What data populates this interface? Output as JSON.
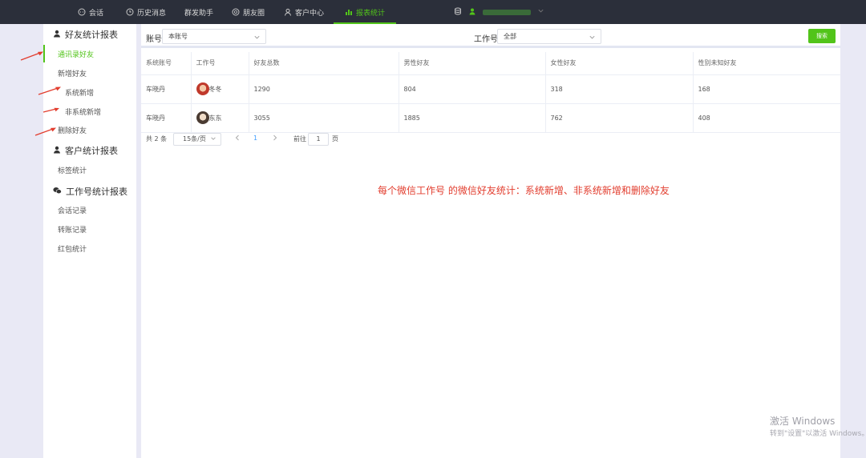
{
  "topnav": {
    "items": [
      {
        "label": "会话"
      },
      {
        "label": "历史消息"
      },
      {
        "label": "群发助手"
      },
      {
        "label": "朋友圈"
      },
      {
        "label": "客户中心"
      },
      {
        "label": "报表统计"
      }
    ],
    "accent": "#52c41a"
  },
  "sidebar": {
    "sections": [
      {
        "title": "好友统计报表",
        "items": [
          "通讯录好友",
          "新增好友",
          "系统新增",
          "非系统新增",
          "删除好友"
        ]
      },
      {
        "title": "客户统计报表",
        "items": [
          "标签统计"
        ]
      },
      {
        "title": "工作号统计报表",
        "items": [
          "会话记录",
          "转账记录",
          "红包统计"
        ]
      }
    ],
    "active_item": "通讯录好友"
  },
  "filters": {
    "account_label": "账号",
    "account_value": "本账号",
    "worker_label": "工作号",
    "worker_value": "全部",
    "search_label": "搜索"
  },
  "table": {
    "columns": [
      "系统账号",
      "工作号",
      "好友总数",
      "男性好友",
      "女性好友",
      "性别未知好友"
    ],
    "rows": [
      {
        "account": "车晓丹",
        "worker": "冬冬",
        "total": "1290",
        "male": "804",
        "female": "318",
        "unknown": "168"
      },
      {
        "account": "车晓丹",
        "worker": "东东",
        "total": "3055",
        "male": "1885",
        "female": "762",
        "unknown": "408"
      }
    ]
  },
  "pager": {
    "total_text": "共 2 条",
    "page_size": "15条/页",
    "current_page": "1",
    "goto_label": "前往",
    "goto_value": "1",
    "page_suffix": "页"
  },
  "annotation": "每个微信工作号 的微信好友统计：系统新增、非系统新增和删除好友",
  "watermark": {
    "line1": "激活 Windows",
    "line2": "转到\"设置\"以激活 Windows。"
  }
}
